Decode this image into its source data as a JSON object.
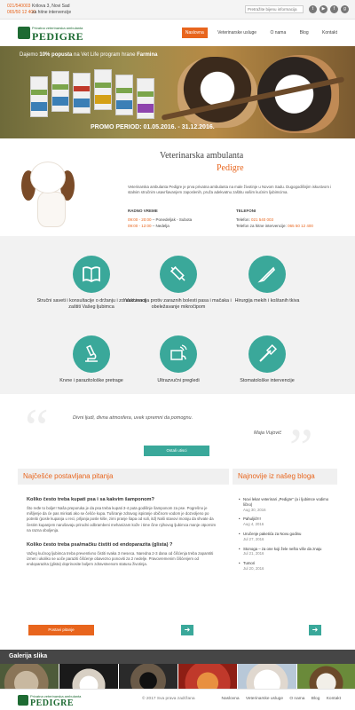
{
  "topbar": {
    "phones": [
      "021/540003",
      "065/50 12 400"
    ],
    "address": "Krilova 3, Novi Sad",
    "emergency": "za hitne intervencije",
    "search_placeholder": "Pretražite bijenu informacija",
    "social": [
      "twitter-icon",
      "youtube-icon",
      "facebook-icon",
      "google-plus-icon"
    ]
  },
  "header": {
    "logo_small": "Privatna veterinarska ambulanta",
    "logo_big": "PEDIGRE",
    "nav": [
      "Naslovna",
      "Veterinarske usluge",
      "O nama",
      "Blog",
      "Kontakt"
    ]
  },
  "hero": {
    "promo_prefix": "Dajemo",
    "promo_bold": "10% popusta",
    "promo_mid": "na Vet Life program hrane",
    "promo_brand": "Farmina",
    "period": "PROMO PERIOD: 01.05.2016. - 31.12.2016."
  },
  "about": {
    "title": "Veterinarska ambulanta",
    "subtitle": "Pedigre",
    "description": "Veterinarska ambulanta Pedigre je prva privatna ambulanta na male životinje u Novom Sadu. Dugogodišnjim iskustvom i stalnim stručnim usavršavanjem zaposlenih, pruža adekvatnu zaštitu vašim kućnim ljubimcima.",
    "hours_label": "RADNO VREME",
    "hours": [
      {
        "time": "09:00 - 20:00",
        "days": "Ponedeljak - Subota"
      },
      {
        "time": "09:00 - 12:00",
        "days": "Nedelja"
      }
    ],
    "phones_label": "TELEFONI",
    "phone_main_label": "Telefon:",
    "phone_main": "021 540 003",
    "phone_emerg_label": "Telefon za hitne intervencije:",
    "phone_emerg": "065 50 12 400"
  },
  "services": [
    {
      "icon": "book-icon",
      "label": "Stručni saveti i konsultacije o držanju i zdravstvenoj zaštiti Vašeg ljubimca"
    },
    {
      "icon": "syringe-icon",
      "label": "Vakcinacija protiv zaraznih bolesti pasa i mačaka i obeležavanje mikročipom"
    },
    {
      "icon": "scalpel-icon",
      "label": "Hirurgija mekih i koštanih tkiva"
    },
    {
      "icon": "microscope-icon",
      "label": "Krvne i parazitološke pretrage"
    },
    {
      "icon": "ultrasound-icon",
      "label": "Ultrazvučni pregledi"
    },
    {
      "icon": "toothbrush-icon",
      "label": "Stomatološke intervencije"
    }
  ],
  "testimonial": {
    "quote": "Divni ljudi, divna atmosfera, uvek spremni da pomognu.",
    "author": "Maja Vujović",
    "button": "Ostali utisci"
  },
  "faq": {
    "title": "Najčešće postavljana pitanja",
    "items": [
      {
        "q": "Koliko često treba kupati psa i sa kakvim šamponom?",
        "a": "Što ređe to bolje!! Naša preporuka je da psa treba kupati 3-4 puta godišnje šamponom za pse. Pogrešno je mišljenje da će pas mirisati ako se češće kupa. Tuširanje zdravog ispiranje običnom vodom je dozvoljeno po potrebi (posle kupanja u reci, prljanja posle kiše, zimi pranje šapa od soli, itd) Naši stavovi moraju da shvate da čestim kupanjem narušavaju prirodni odbrambeni mehanizam kože i time čine njihovog ljubimca manje otpornim na razna oboljenja."
      },
      {
        "q": "Koliko često treba psa/mačku čistiti od endoparazita (glista) ?",
        "a": "Važeg kućnog ljubimca treba preventivno čistiti svaka 3 meseca. Naredna 2-3 dana od čišćenja treba zapamtiti izmet i ukoliko se uoče paraziti čišćenje obavezno ponoviti za 2 nedelje. Pravovremenim čišćenjem od endoparazita (glista) doprinosite boljem zdravstvenom statusu životinja."
      }
    ],
    "button": "Postavi pitanje"
  },
  "blog": {
    "title": "Najnovije iz našeg bloga",
    "items": [
      {
        "t": "Novi lekar veterinari „Pedigre\" (a i ljubimce vodimo lično)",
        "d": "Aug 30, 2016"
      },
      {
        "t": "Pahuljić!!!!",
        "d": "Aug 4, 2016"
      },
      {
        "t": "Uručenje paketića za Novu godinu",
        "d": "Jul 27, 2016"
      },
      {
        "t": "Stonoga – za one koji žele nešto više da znaju",
        "d": "Jul 21, 2016"
      },
      {
        "t": "Tumori",
        "d": "Jul 20, 2016"
      }
    ]
  },
  "gallery": {
    "title": "Galerija slika",
    "count": 6
  },
  "footer": {
    "copy": "© 2017 Sva prava zadržana",
    "nav": [
      "Naslovna",
      "Veterinarske usluge",
      "O nama",
      "Blog",
      "Kontakt"
    ]
  },
  "colors": {
    "accent": "#e8651d",
    "teal": "#3aa89a",
    "brand": "#1e6b33"
  }
}
